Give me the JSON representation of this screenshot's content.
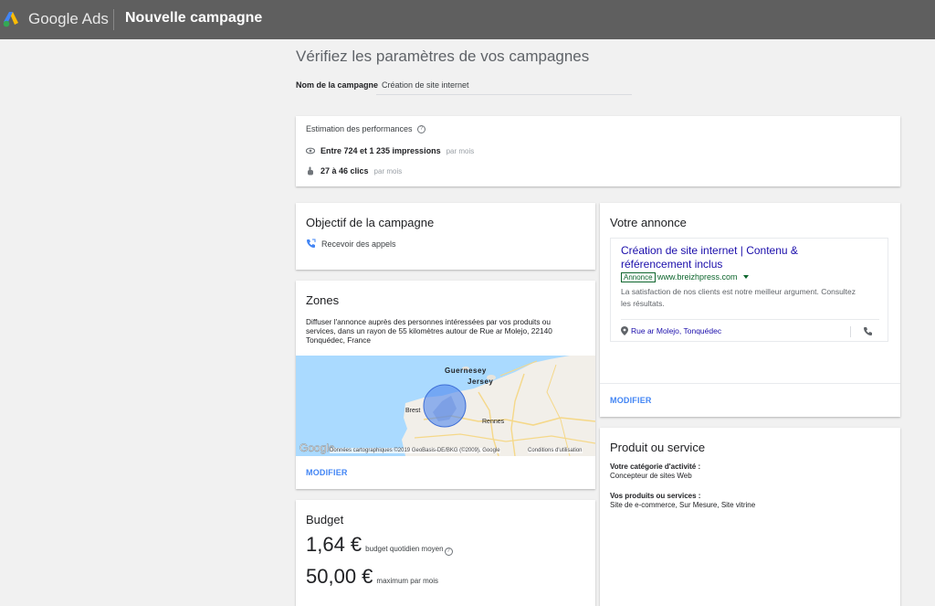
{
  "header": {
    "brand": "Google Ads",
    "title": "Nouvelle campagne"
  },
  "page": {
    "heading": "Vérifiez les paramètres de vos campagnes",
    "campaign_name_label": "Nom de la campagne",
    "campaign_name_value": "Création de site internet"
  },
  "performance": {
    "title": "Estimation des performances",
    "help": "?",
    "impressions": "Entre 724 et 1 235 impressions",
    "impressions_unit": "par mois",
    "clicks": "27 à 46 clics",
    "clicks_unit": "par mois"
  },
  "objective": {
    "title": "Objectif de la campagne",
    "item": "Recevoir des appels"
  },
  "zones": {
    "title": "Zones",
    "description": "Diffuser l'annonce auprès des personnes intéressées par vos produits ou services, dans un rayon de 55 kilomètres autour de Rue ar Molejo, 22140 Tonquédec, France",
    "map_labels": {
      "guernesey": "Guernesey",
      "jersey": "Jersey",
      "brest": "Brest",
      "rennes": "Rennes"
    },
    "map_logo": "Google",
    "map_attribution": "Données cartographiques ©2019 GeoBasis-DE/BKG (©2009), Google",
    "map_terms": "Conditions d'utilisation",
    "modify_label": "MODIFIER"
  },
  "budget": {
    "title": "Budget",
    "daily_value": "1,64 €",
    "daily_label": "budget quotidien moyen",
    "monthly_value": "50,00 €",
    "monthly_label": "maximum par mois"
  },
  "ad": {
    "title": "Votre annonce",
    "headline": "Création de site internet | Contenu & référencement inclus",
    "badge": "Annonce",
    "url": "www.breizhpress.com",
    "description": "La satisfaction de nos clients est notre meilleur argument. Consultez les résultats.",
    "location": "Rue ar Molejo, Tonquédec",
    "modify_label": "MODIFIER"
  },
  "product": {
    "title": "Produit ou service",
    "category_label": "Votre catégorie d'activité :",
    "category_value": "Concepteur de sites Web",
    "services_label": "Vos produits ou services :",
    "services_value": "Site de e-commerce, Sur Mesure, Site vitrine"
  },
  "colors": {
    "topbar": "#5f5f5f",
    "link": "#4285f4",
    "ad_headline": "#1a0dab",
    "ad_url": "#0d652d",
    "sea": "#aadaff",
    "land": "#f2efe9",
    "radius_circle": "#4285f4"
  },
  "icons": [
    "google-ads-logo-icon",
    "help-icon",
    "eye-icon",
    "click-icon",
    "phone-call-icon",
    "location-pin-icon",
    "phone-icon",
    "dropdown-arrow-icon"
  ]
}
